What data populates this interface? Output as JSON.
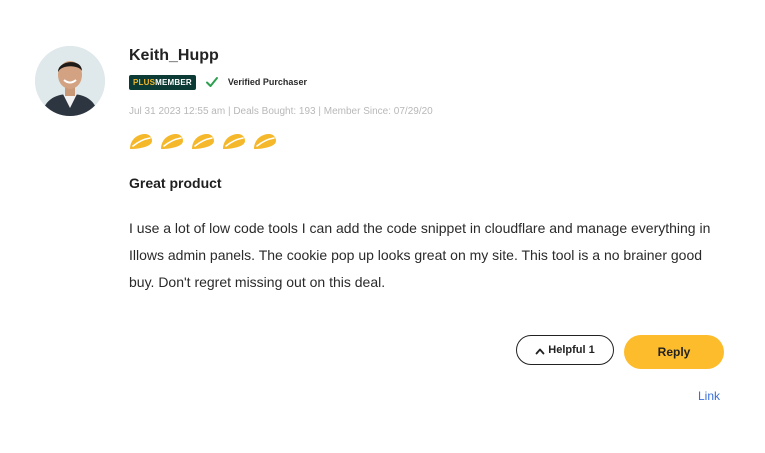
{
  "review": {
    "username": "Keith_Hupp",
    "badge": {
      "plus": "PLUS",
      "member": "MEMBER"
    },
    "verified_label": "Verified Purchaser",
    "meta": "Jul 31 2023 12:55 am | Deals Bought: 193 | Member Since: 07/29/20",
    "rating": {
      "value": 5,
      "max": 5,
      "icon": "taco-icon",
      "color": "#F4B82A"
    },
    "title": "Great product",
    "body": "I use a lot of low code tools I can add the code snippet in cloudflare and manage everything in Illows admin panels. The cookie pop up looks great on my site. This tool is a no brainer good buy. Don't regret missing out on this deal."
  },
  "actions": {
    "helpful_label": "Helpful",
    "helpful_count": "1",
    "reply_label": "Reply",
    "link_label": "Link"
  },
  "colors": {
    "accent": "#FCBC2C",
    "badge_bg": "#0B3B34",
    "verified_check": "#2E9E4F",
    "link": "#3B6FD8",
    "meta_text": "#B8B8B8"
  }
}
